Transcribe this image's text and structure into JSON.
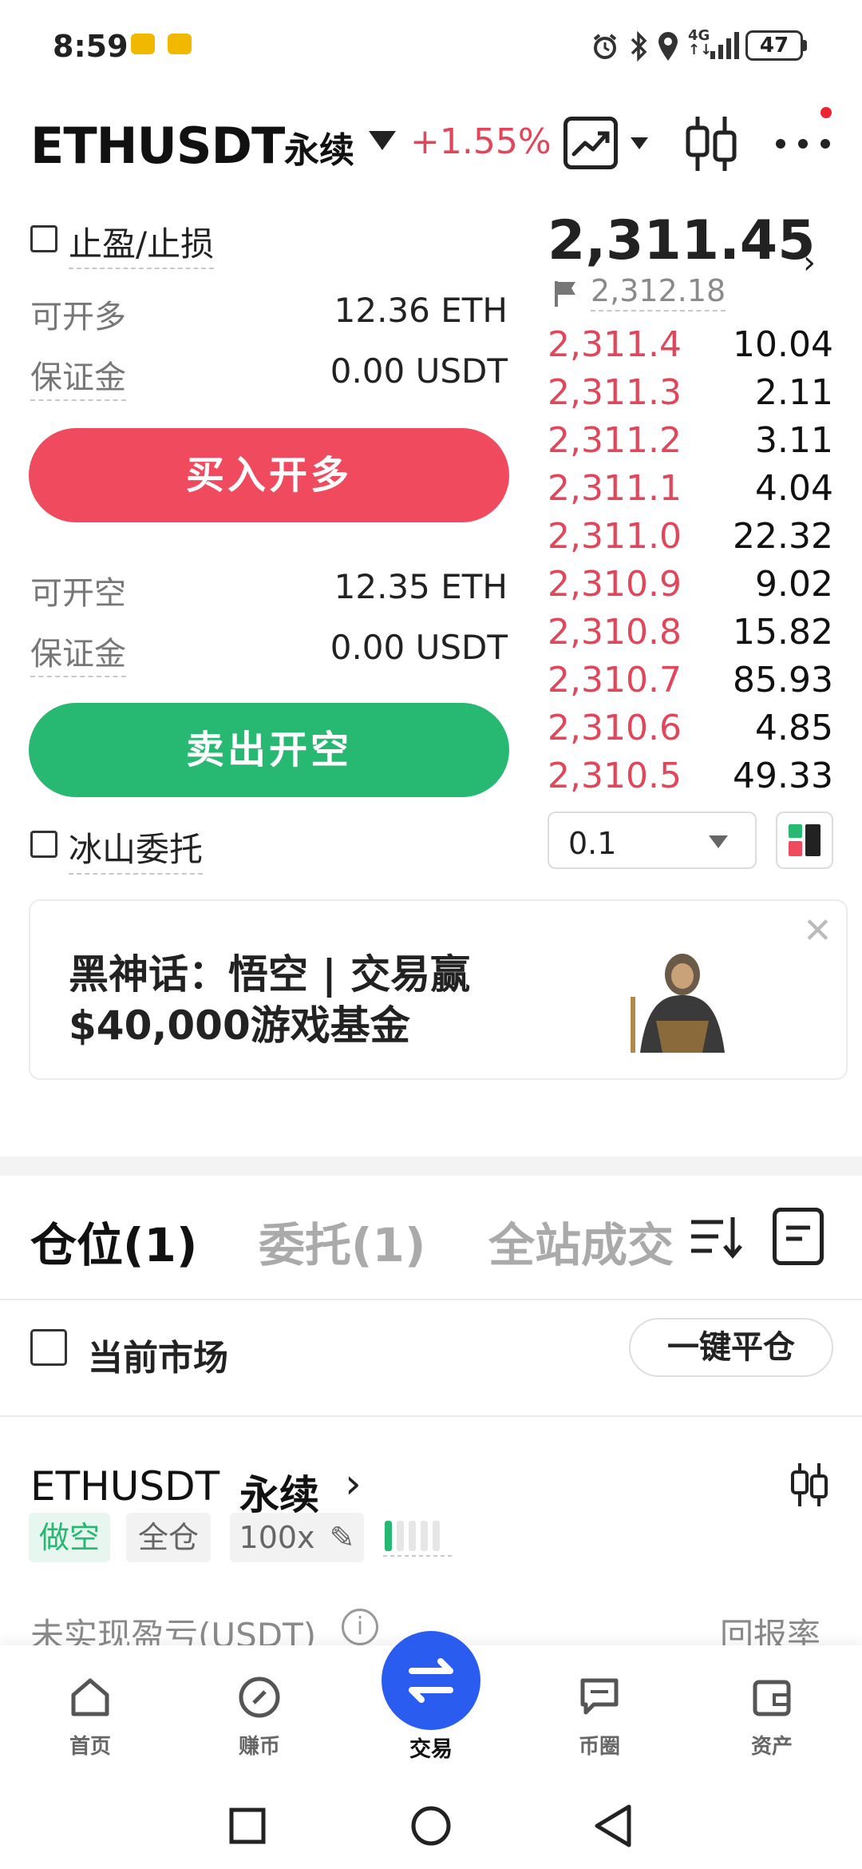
{
  "status_bar": {
    "time": "8:59",
    "battery": "47",
    "icons": [
      "alarm-icon",
      "bluetooth-icon",
      "location-icon",
      "signal-4g-icon",
      "battery-icon"
    ]
  },
  "header": {
    "symbol": "ETHUSDT",
    "contract_type": "永续",
    "change": "+1.55%",
    "icons": [
      "chart-icon",
      "candlestick-icon",
      "more-icon"
    ]
  },
  "trade_panel": {
    "tp_sl_label": "止盈/止损",
    "long": {
      "available_label": "可开多",
      "available_value": "12.36 ETH",
      "margin_label": "保证金",
      "margin_value": "0.00 USDT",
      "button": "买入开多"
    },
    "short": {
      "available_label": "可开空",
      "available_value": "12.35 ETH",
      "margin_label": "保证金",
      "margin_value": "0.00 USDT",
      "button": "卖出开空"
    },
    "iceberg_label": "冰山委托"
  },
  "order_book": {
    "last_price": "2,311.45",
    "mark_price": "2,312.18",
    "asks": [
      {
        "price": "2,311.4",
        "size": "10.04"
      },
      {
        "price": "2,311.3",
        "size": "2.11"
      },
      {
        "price": "2,311.2",
        "size": "3.11"
      },
      {
        "price": "2,311.1",
        "size": "4.04"
      },
      {
        "price": "2,311.0",
        "size": "22.32"
      },
      {
        "price": "2,310.9",
        "size": "9.02"
      },
      {
        "price": "2,310.8",
        "size": "15.82"
      },
      {
        "price": "2,310.7",
        "size": "85.93"
      },
      {
        "price": "2,310.6",
        "size": "4.85"
      },
      {
        "price": "2,310.5",
        "size": "49.33"
      }
    ],
    "depth_step": "0.1"
  },
  "banner": {
    "line1": "黑神话：悟空 | 交易赢",
    "line2": "$40,000游戏基金"
  },
  "tabs": {
    "positions": "仓位(1)",
    "orders": "委托(1)",
    "trades": "全站成交"
  },
  "filter": {
    "current_market": "当前市场",
    "close_all": "一键平仓"
  },
  "position": {
    "symbol": "ETHUSDT",
    "contract_type": "永续",
    "side_tag": "做空",
    "margin_mode_tag": "全仓",
    "leverage_tag": "100x",
    "upnl_label": "未实现盈亏(USDT)",
    "roe_label": "回报率"
  },
  "bottom_nav": [
    {
      "label": "首页",
      "icon": "home-icon"
    },
    {
      "label": "赚币",
      "icon": "earn-icon"
    },
    {
      "label": "交易",
      "icon": "trade-icon"
    },
    {
      "label": "币圈",
      "icon": "community-icon"
    },
    {
      "label": "资产",
      "icon": "wallet-icon"
    }
  ],
  "colors": {
    "buy": "#f04a5e",
    "sell": "#27b872",
    "ask_price": "#e0475b",
    "primary": "#2a5cf0"
  }
}
